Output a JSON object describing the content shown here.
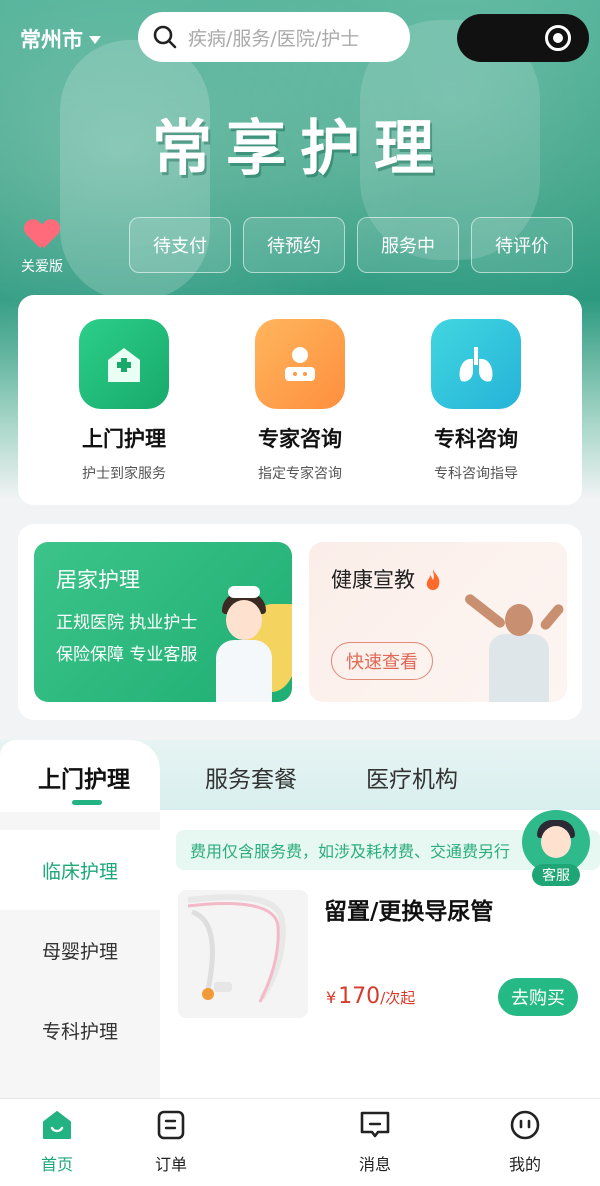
{
  "header": {
    "city": "常州市",
    "search_placeholder": "疾病/服务/医院/护士",
    "brand_title": "常享护理",
    "care_mode_label": "关爱版"
  },
  "order_status": [
    "待支付",
    "待预约",
    "服务中",
    "待评价"
  ],
  "services": [
    {
      "title": "上门护理",
      "subtitle": "护士到家服务",
      "icon": "home-plus-icon",
      "color": "#22b479"
    },
    {
      "title": "专家咨询",
      "subtitle": "指定专家咨询",
      "icon": "doctor-icon",
      "color": "#ffa34f"
    },
    {
      "title": "专科咨询",
      "subtitle": "专科咨询指导",
      "icon": "lungs-icon",
      "color": "#33c8dc"
    }
  ],
  "promo": {
    "home_care": {
      "title": "居家护理",
      "lines": [
        "正规医院 执业护士",
        "保险保障 专业客服"
      ]
    },
    "health_edu": {
      "title": "健康宣教",
      "button": "快速查看"
    }
  },
  "tabs": [
    "上门护理",
    "服务套餐",
    "医疗机构"
  ],
  "categories": [
    "临床护理",
    "母婴护理",
    "专科护理"
  ],
  "notice": "费用仅含服务费，如涉及耗材费、交通费另行",
  "product": {
    "title": "留置/更换导尿管",
    "currency": "¥",
    "price": "170",
    "unit": "/次起",
    "buy_label": "去购买"
  },
  "customer_service_label": "客服",
  "nav": [
    {
      "label": "首页",
      "icon": "home-icon",
      "active": true
    },
    {
      "label": "订单",
      "icon": "order-icon",
      "active": false
    },
    {
      "label": "消息",
      "icon": "message-icon",
      "active": false
    },
    {
      "label": "我的",
      "icon": "profile-icon",
      "active": false
    }
  ],
  "colors": {
    "accent": "#23b383",
    "price": "#d83a2a"
  }
}
